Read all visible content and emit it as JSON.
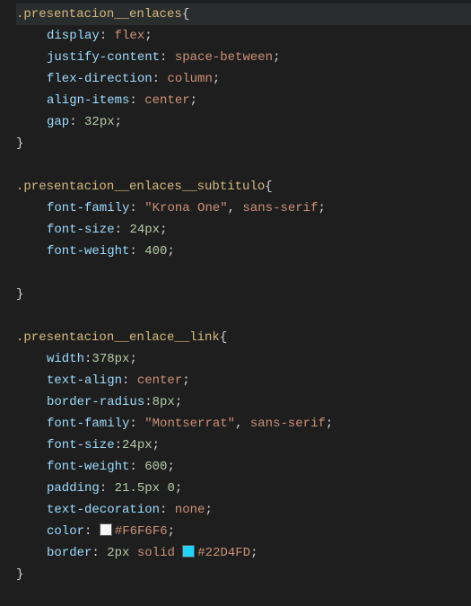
{
  "rules": [
    {
      "selector": ".presentacion__enlaces",
      "highlight": true,
      "decls": [
        {
          "prop": "display",
          "value": "flex",
          "type": "kw"
        },
        {
          "prop": "justify-content",
          "value": "space-between",
          "type": "kw"
        },
        {
          "prop": "flex-direction",
          "value": "column",
          "type": "kw"
        },
        {
          "prop": "align-items",
          "value": "center",
          "type": "kw"
        },
        {
          "prop": "gap",
          "num": "32",
          "unit": "px",
          "type": "num"
        }
      ],
      "blankAfter": true
    },
    {
      "selector": ".presentacion__enlaces__subtitulo",
      "decls": [
        {
          "prop": "font-family",
          "parts": [
            "\"Krona One\"",
            ", ",
            "sans-serif"
          ],
          "type": "fontlist"
        },
        {
          "prop": "font-size",
          "num": "24",
          "unit": "px",
          "type": "num"
        },
        {
          "prop": "font-weight",
          "num": "400",
          "type": "num"
        }
      ],
      "blankInside": true,
      "blankAfter": true
    },
    {
      "selector": ".presentacion__enlace__link",
      "decls": [
        {
          "prop": "width",
          "num": "378",
          "unit": "px",
          "type": "num",
          "nospace": true
        },
        {
          "prop": "text-align",
          "value": "center",
          "type": "kw"
        },
        {
          "prop": "border-radius",
          "num": "8",
          "unit": "px",
          "type": "num",
          "nospace": true
        },
        {
          "prop": "font-family",
          "parts": [
            "\"Montserrat\"",
            ", ",
            "sans-serif"
          ],
          "type": "fontlist"
        },
        {
          "prop": "font-size",
          "num": "24",
          "unit": "px",
          "type": "num",
          "nospace": true
        },
        {
          "prop": "font-weight",
          "num": "600",
          "type": "num"
        },
        {
          "prop": "padding",
          "pair": [
            {
              "num": "21.5",
              "unit": "px"
            },
            {
              "num": "0"
            }
          ],
          "type": "pair"
        },
        {
          "prop": "text-decoration",
          "value": "none",
          "type": "kw"
        },
        {
          "prop": "color",
          "color": "#F6F6F6",
          "type": "color"
        },
        {
          "prop": "border",
          "border": {
            "num": "2",
            "unit": "px",
            "style": "solid",
            "color": "#22D4FD"
          },
          "type": "border"
        }
      ]
    }
  ]
}
